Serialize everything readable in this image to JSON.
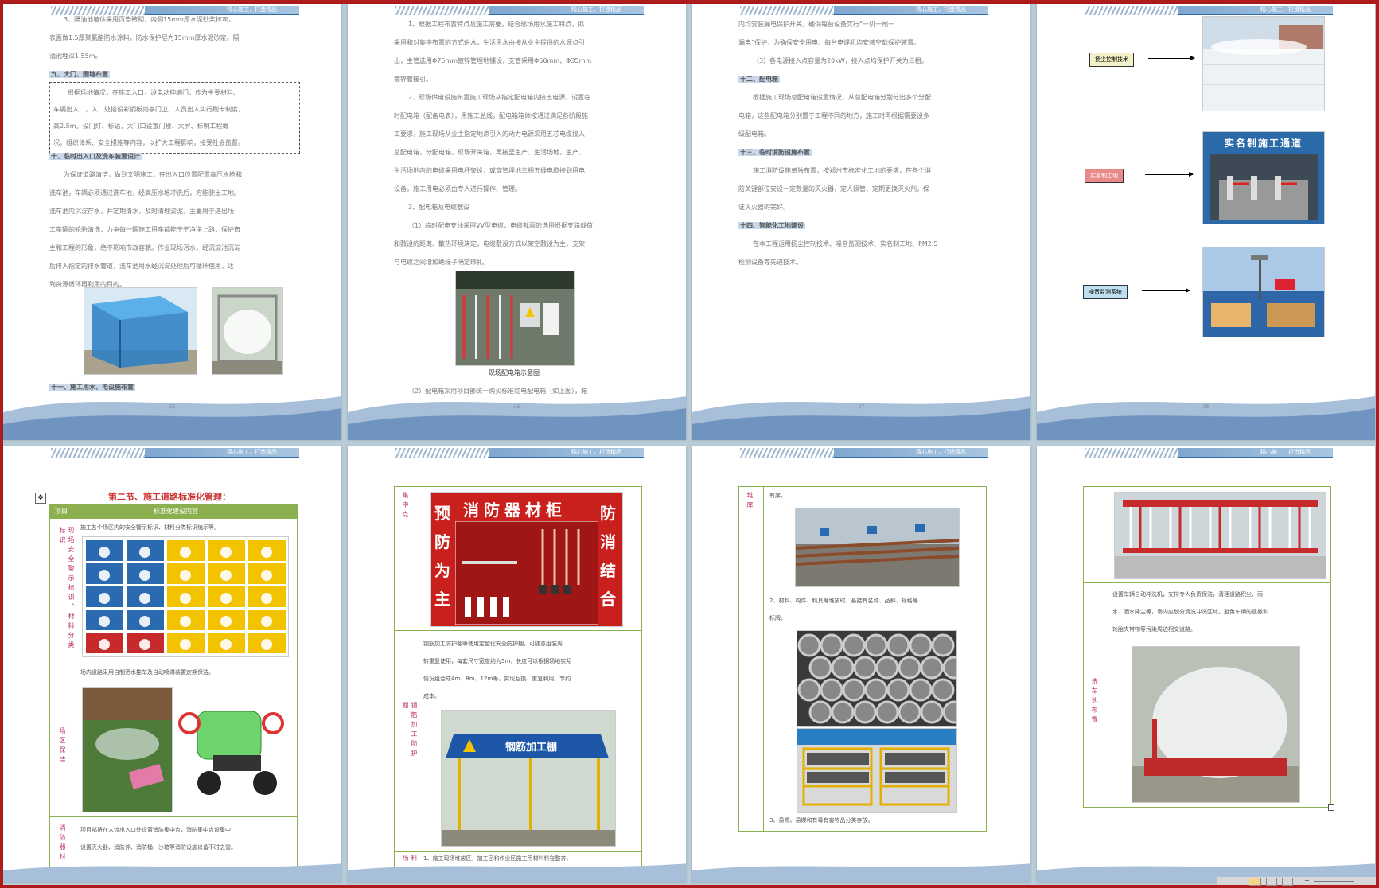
{
  "header_text": "精心施工，打造精品",
  "page_numbers": [
    "25",
    "26",
    "27",
    "28",
    "29",
    "30",
    "31",
    "32"
  ],
  "p1": {
    "lines": [
      "3、隔油池墙体采用页岩砖砌，内侧15mm厚水泥砂浆抹灰，",
      "表面做1.5厚聚氨酯防水涂料，防水保护层为15mm厚水泥砂浆。隔",
      "油池埋深1.55m。"
    ],
    "h_gate": "九、大门、围墙布置",
    "gate_lines": [
      "根据场地情况，在施工入口，设电动伸缩门，作为主要材料、",
      "车辆出入口，入口处搭设彩钢板岗亭门卫，人员出入实行刷卡制度，",
      "高2.5m。设门灯、标语，大门口设置门楼、大屏、标明工程概",
      "况，组织体系、安全措施等内容，以扩大工程影响，接受社会监督。"
    ],
    "h_wash": "十、临时出入口及洗车装置设计",
    "wash_lines": [
      "为保证道路清洁，做到文明施工，在出入口位置配置高压水枪和",
      "洗车池，车辆必须通过洗车池，经高压水枪冲洗后，方能驶出工地。",
      "洗车池内沉淀存水，并定期清水，及时清理淤泥，主要用于进出场",
      "工车辆的轮胎清洗，力争每一辆施工用车都能干干净净上路，保护市",
      "主和工程的形象，绝不影响市政容貌。作业现场污水，经沉淀池沉淀",
      "后排入指定的排水管道，洗车池用水经沉淀处理后可循环使用，达",
      "到资源循环再利用的目的。"
    ],
    "h_next": "十一、施工用水、电设施布置"
  },
  "p2": {
    "lines": [
      "1、根据工程布置特点及施工需要，结合现场用水施工特点，拟",
      "采用和对集中布置的方式供水，生活用水由接从业主提供的水源点引",
      "出，主管选用Φ75mm镀锌管埋地铺设，支管采用Φ50mm、Φ35mm",
      "镀锌管接引。",
      "2、现场供电设施布置施工现场从指定配电箱内接出电源，设置临",
      "时配电箱（配备电表），用施工总线，配电箱箱体按通过满足各阶段施",
      "工要求，施工现场从业主指定地点引入的动力电源采用五芯电缆接入",
      "总配电箱，分配电箱，现场开关箱，再接至生产、生活场地，生产、",
      "生活场地内的电缆采用电杆架设，或穿管埋地三相五线电缆接到用电",
      "设备，施工用电必须由专人进行操作、管理。",
      "3、配电箱及电缆敷设",
      "（1）临时配电支线采用VV型电缆，电缆截面的选用根据支路载荷",
      "和敷设的距离、散热环境决定，电缆敷设方式以架空敷设为主，支架",
      "与电缆之间增加绝缘子隔定绑扎。"
    ],
    "caption": "现场配电箱示意图",
    "bottom": "（2）配电箱采用项目部统一购买标准临电配电箱（如上图），箱"
  },
  "p3": {
    "lines": [
      "内均安装漏电保护开关，确保每台设备实行“一机一闸一",
      "漏电”保护，为确保安全用电，每台电焊机均安装空载保护装置。",
      "（3）各电源接入点容量为20kW，接入点均保护开关为三相。"
    ],
    "h_box": "十二、配电箱",
    "box_lines": [
      "根据施工现场总配电箱设置情况，从总配电箱分别分出多个分配",
      "电箱，这些配电箱分别置于工程不同的地方，施工时再根据需要设多",
      "级配电箱。"
    ],
    "h_fire": "十三、临时消防设施布置",
    "fire_lines": [
      "施工消防设施单独布置，按郑州市标准化工地的要求，在各个消",
      "防关键部位安设一定数量的灭火器，定人照管、定期更换灭火剂，保",
      "证灭火器的完好。"
    ],
    "h_smart": "十四、智能化工地建设",
    "smart_lines": [
      "在本工程运用扬尘控制技术、噪音监测技术、实名制工地、PM2.5",
      "检测设备等先进技术。"
    ]
  },
  "p4": {
    "labels": [
      "扬尘控制技术",
      "实名制工地",
      "噪音监测系统"
    ],
    "banner": "实名制施工通道"
  },
  "p5": {
    "title": "第二节、施工道路标准化管理：",
    "table_head_left": "项目",
    "table_head_right": "标准化建设内容",
    "row1_label": "现场安全警示标识、材料分类标识",
    "row1_text": "施工各个场区内的安全警示标识、材料分类标识统示等。",
    "row2_label": "场区保洁",
    "row2_text": "场内道路采用自制洒水推车及自动喷淋装置定期保洁。",
    "row3_label": "消防器材",
    "row3_lines": [
      "项目部将在人流出入口处设置消防集中点，消防集中点设集中",
      "设置灭火器、消防斧、消防桶、沙箱等消防设施以备不时之需。"
    ]
  },
  "p6": {
    "row1_label": "集中点",
    "cabinet_title": "消防器材柜",
    "left_slogan": "预防为主",
    "right_slogan": "防消结合",
    "row2_text_lines": [
      "钢筋加工防护棚等使用定型化安全防护棚，可随意组装周",
      "转重复使用，每套尺寸宽度约为5m，长度可以根据场地实际",
      "情况组合成4m、8m、12m等，实现互换、重复利用、节约",
      "成本。"
    ],
    "row2_label": "钢筋加工防护棚",
    "shed_sign": "钢筋加工棚",
    "row3_label": "料场",
    "row3_text": "1、施工现场堆放区，加工区和作业区施工用材料料在整齐、"
  },
  "p7": {
    "row1_label": "堆库",
    "row1_text": "有序。",
    "item2": "2、材料、构件、料具等堆放时，悬挂有名称、品种、规格等",
    "item2b": "标牌。",
    "item3": "3、易燃、易爆和有毒有害物品分类存放。"
  },
  "p8": {
    "row2_label": "洗车池布置",
    "row2_lines": [
      "设置车辆自动冲洗机，安排专人负责保洁，清理道路积尘、雨",
      "水、洒水降尘等，场内应划分清洗冲洗区域，避免车辆的遗撒和",
      "轮胎夹带物等污染周边相交道路。"
    ]
  },
  "colors": {
    "frame": "#b01c1c",
    "heading_bg": "#c9d8ea",
    "table_border": "#8cb04f",
    "accent_red": "#c33"
  }
}
